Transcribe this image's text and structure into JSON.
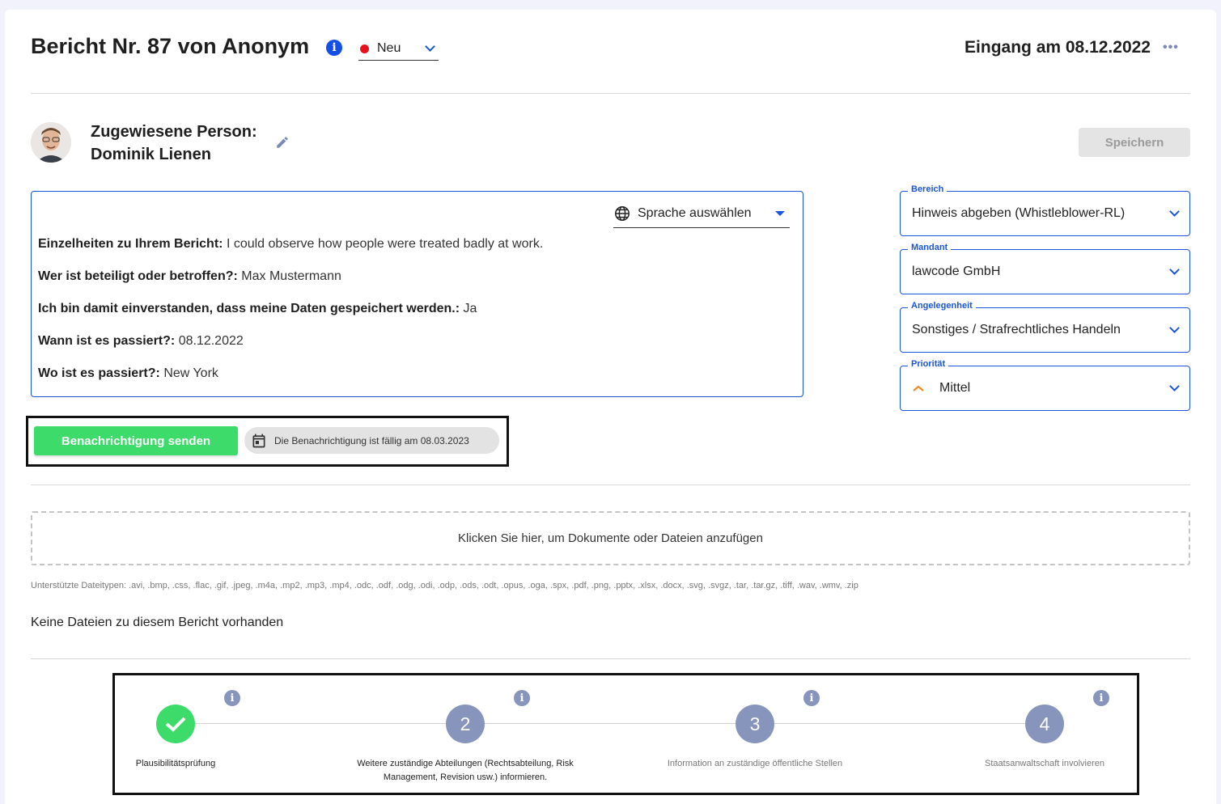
{
  "header": {
    "title": "Bericht Nr. 87 von Anonym",
    "status": "Neu",
    "eingang": "Eingang am 08.12.2022",
    "more_icon": "more-horizontal-icon"
  },
  "assignee": {
    "label": "Zugewiesene Person:",
    "name": "Dominik Lienen",
    "save_label": "Speichern"
  },
  "report": {
    "language_select": "Sprache auswählen",
    "fields": [
      {
        "label": "Einzelheiten zu Ihrem Bericht:",
        "value": "I could observe how people were treated badly at work."
      },
      {
        "label": "Wer ist beteiligt oder betroffen?:",
        "value": "Max Mustermann"
      },
      {
        "label": "Ich bin damit einverstanden, dass meine Daten gespeichert werden.:",
        "value": "Ja"
      },
      {
        "label": "Wann ist es passiert?:",
        "value": "08.12.2022"
      },
      {
        "label": "Wo ist es passiert?:",
        "value": "New York"
      }
    ]
  },
  "side_fields": [
    {
      "label": "Bereich",
      "value": "Hinweis abgeben (Whistleblower-RL)"
    },
    {
      "label": "Mandant",
      "value": "lawcode GmbH"
    },
    {
      "label": "Angelegenheit",
      "value": "Sonstiges / Strafrechtliches Handeln"
    },
    {
      "label": "Priorität",
      "value": "Mittel"
    }
  ],
  "notification": {
    "button_label": "Benachrichtigung senden",
    "due_text": "Die Benachrichtigung ist fällig am 08.03.2023"
  },
  "upload": {
    "prompt": "Klicken Sie hier, um Dokumente oder Dateien anzufügen",
    "supported_types": "Unterstützte Dateitypen: .avi, .bmp, .css, .flac, .gif, .jpeg, .m4a, .mp2, .mp3, .mp4, .odc, .odf, .odg, .odi, .odp, .ods, .odt, .opus, .oga, .spx, .pdf, .png, .pptx, .xlsx, .docx, .svg, .svgz, .tar, .tar.gz, .tiff, .wav, .wmv, .zip",
    "no_files": "Keine Dateien zu diesem Bericht vorhanden"
  },
  "steps": [
    {
      "number": "",
      "label": "Plausibilitätsprüfung",
      "status": "done"
    },
    {
      "number": "2",
      "label": "Weitere zuständige Abteilungen (Rechtsabteilung, Risk Management, Revision usw.) informieren.",
      "status": "pending"
    },
    {
      "number": "3",
      "label": "Information an zuständige öffentliche Stellen",
      "status": "pending"
    },
    {
      "number": "4",
      "label": "Staatsanwaltschaft involvieren",
      "status": "pending"
    }
  ],
  "colors": {
    "accent": "#1a56db",
    "success": "#3ddc6a",
    "status_new": "#e8111b",
    "priority_medium": "#f08a24",
    "step_pending": "#8795bd"
  }
}
